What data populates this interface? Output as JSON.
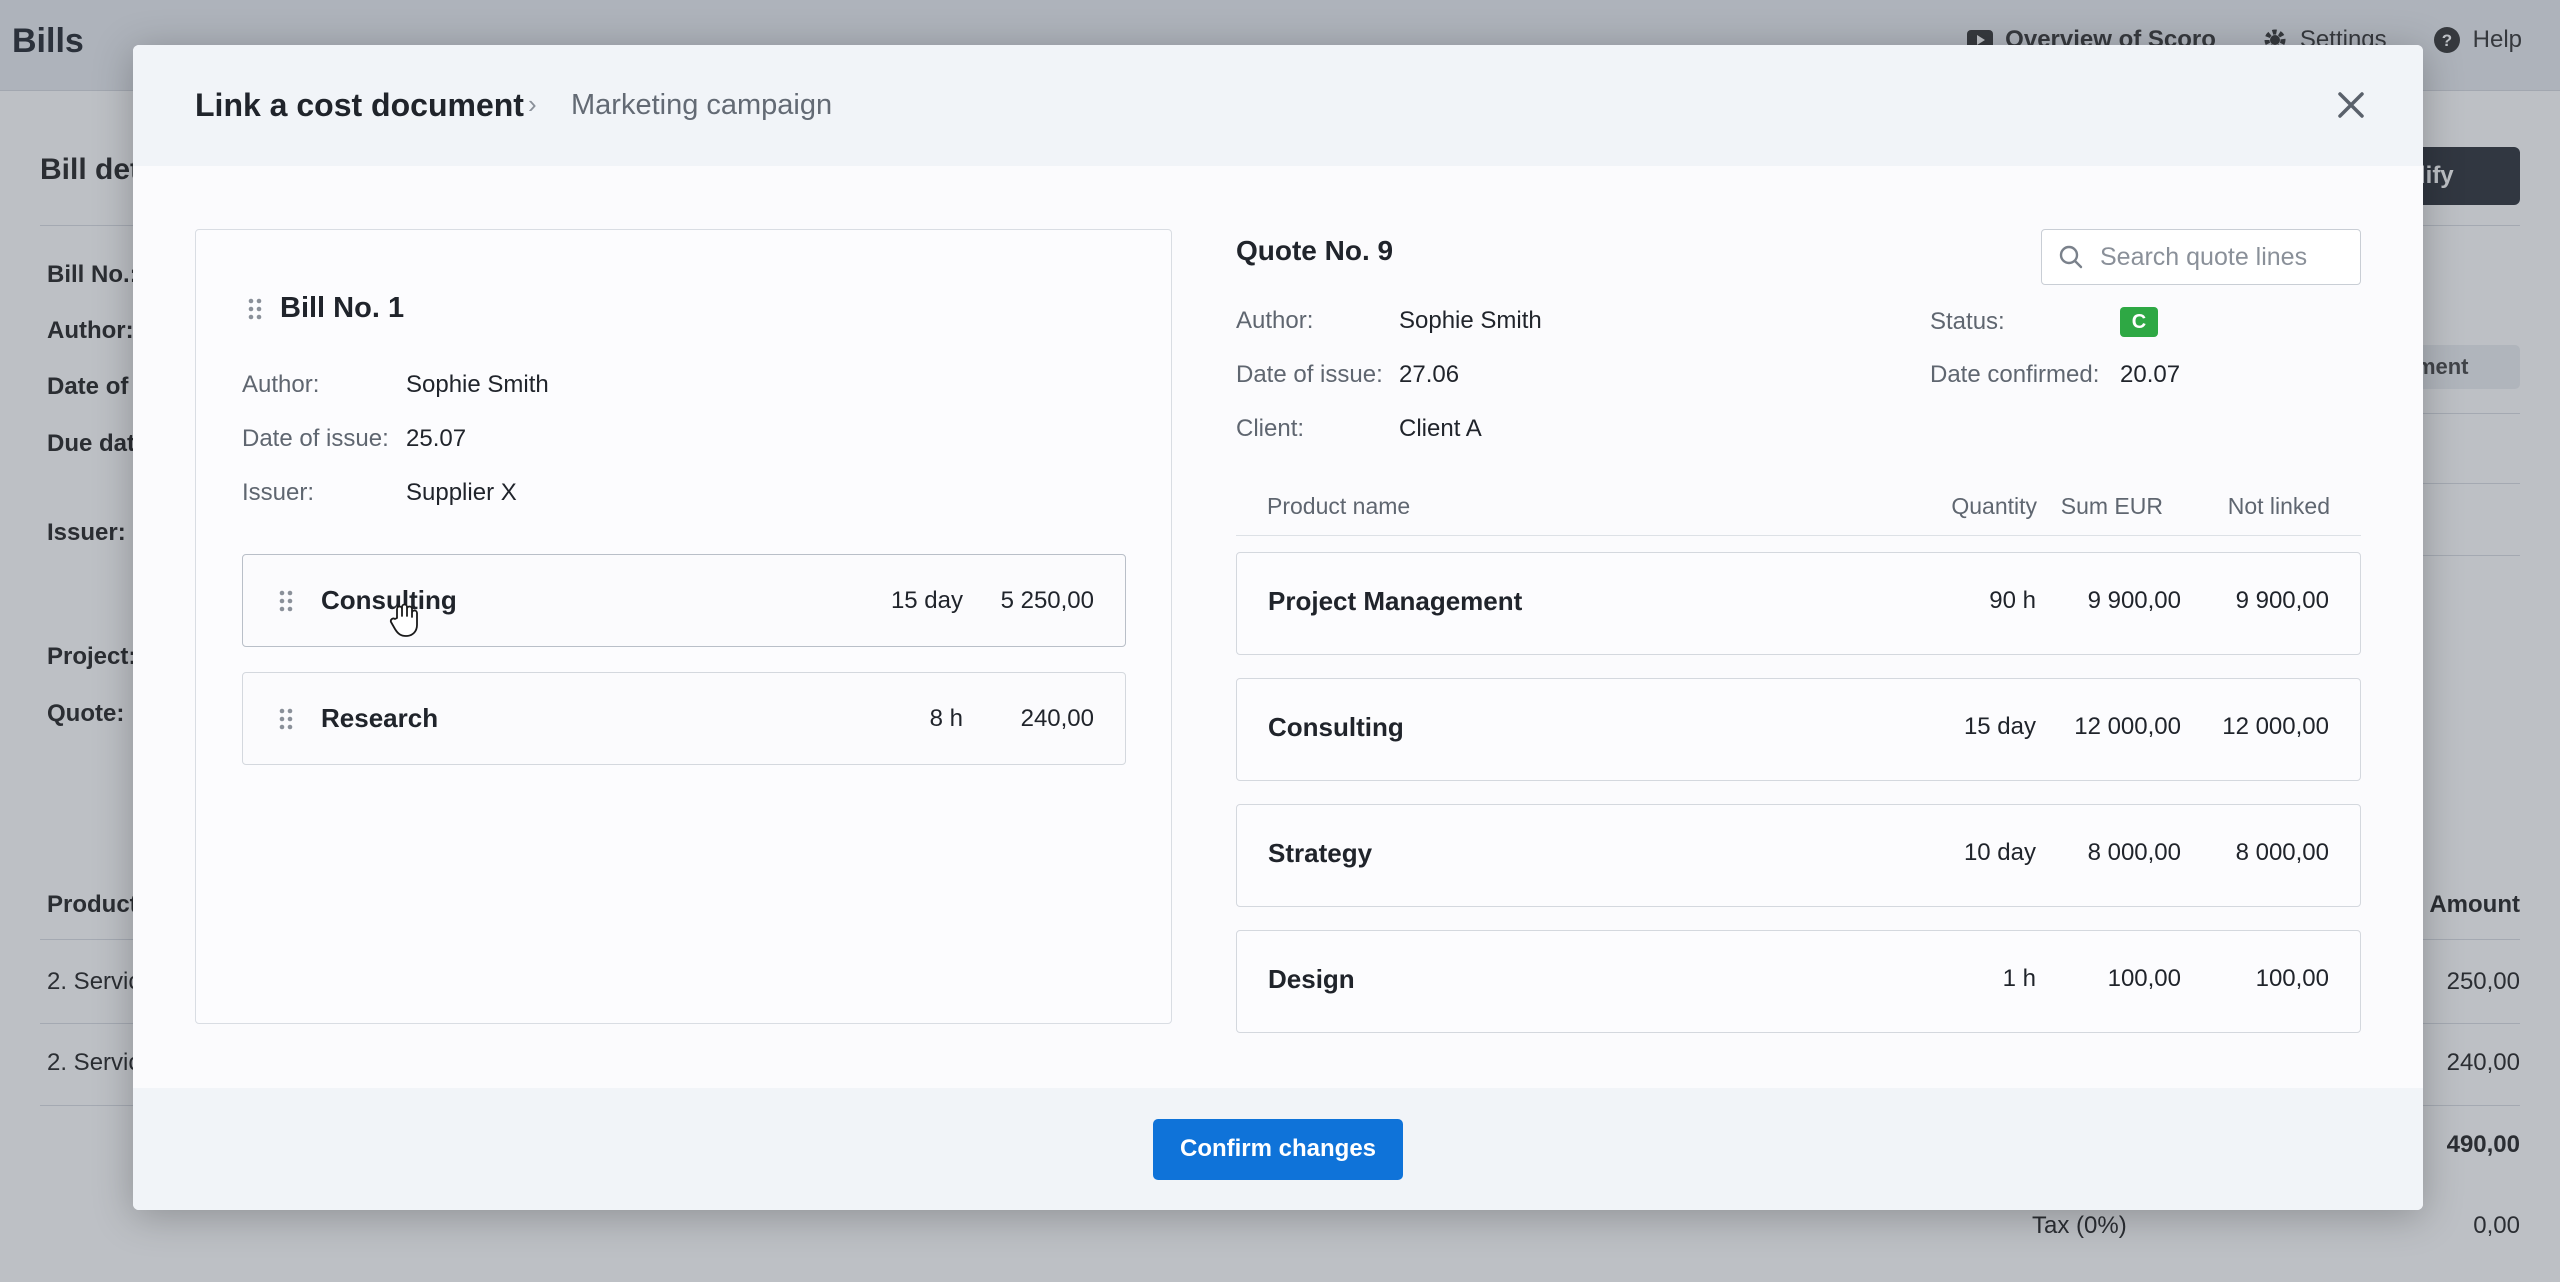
{
  "app": {
    "title": "Bills",
    "nav": [
      "Overview of Scoro",
      "Settings",
      "Help"
    ]
  },
  "background": {
    "heading": "Bill det",
    "modify_button": "odify",
    "payment_button": "ayment",
    "labels": [
      "Bill No.:",
      "Author:",
      "Date of",
      "Due dat",
      "Issuer:",
      "Project:",
      "Quote:"
    ],
    "product_header": "Product",
    "amount_header": "Amount",
    "rows": [
      {
        "name": "2. Servic",
        "amount": "250,00"
      },
      {
        "name": "2. Servic",
        "amount": "240,00"
      }
    ],
    "total": "490,00",
    "tax_label": "Tax (0%)",
    "tax_value": "0,00"
  },
  "modal": {
    "title": "Link a cost document",
    "breadcrumb_sep": "›",
    "subtitle": "Marketing campaign",
    "confirm_label": "Confirm changes"
  },
  "bill": {
    "title": "Bill No. 1",
    "author_label": "Author:",
    "author": "Sophie Smith",
    "date_label": "Date of issue:",
    "date": "25.07",
    "issuer_label": "Issuer:",
    "issuer": "Supplier X",
    "lines": [
      {
        "name": "Consulting",
        "qty": "15 day",
        "sum": "5 250,00"
      },
      {
        "name": "Research",
        "qty": "8 h",
        "sum": "240,00"
      }
    ]
  },
  "quote": {
    "title": "Quote No. 9",
    "search_placeholder": "Search quote lines",
    "author_label": "Author:",
    "author": "Sophie Smith",
    "date_label": "Date of issue:",
    "date": "27.06",
    "client_label": "Client:",
    "client": "Client A",
    "status_label": "Status:",
    "status": "C",
    "status_color": "#2ea844",
    "confirmed_label": "Date confirmed:",
    "confirmed": "20.07",
    "columns": {
      "name": "Product name",
      "qty": "Quantity",
      "sum": "Sum EUR",
      "not_linked": "Not linked"
    },
    "lines": [
      {
        "name": "Project Management",
        "qty": "90 h",
        "sum": "9 900,00",
        "not_linked": "9 900,00"
      },
      {
        "name": "Consulting",
        "qty": "15 day",
        "sum": "12 000,00",
        "not_linked": "12 000,00"
      },
      {
        "name": "Strategy",
        "qty": "10 day",
        "sum": "8 000,00",
        "not_linked": "8 000,00"
      },
      {
        "name": "Design",
        "qty": "1 h",
        "sum": "100,00",
        "not_linked": "100,00"
      }
    ]
  },
  "colors": {
    "accent": "#0f73d9",
    "modal_header_bg": "#f1f4f8",
    "dark_button": "#2b3038"
  }
}
